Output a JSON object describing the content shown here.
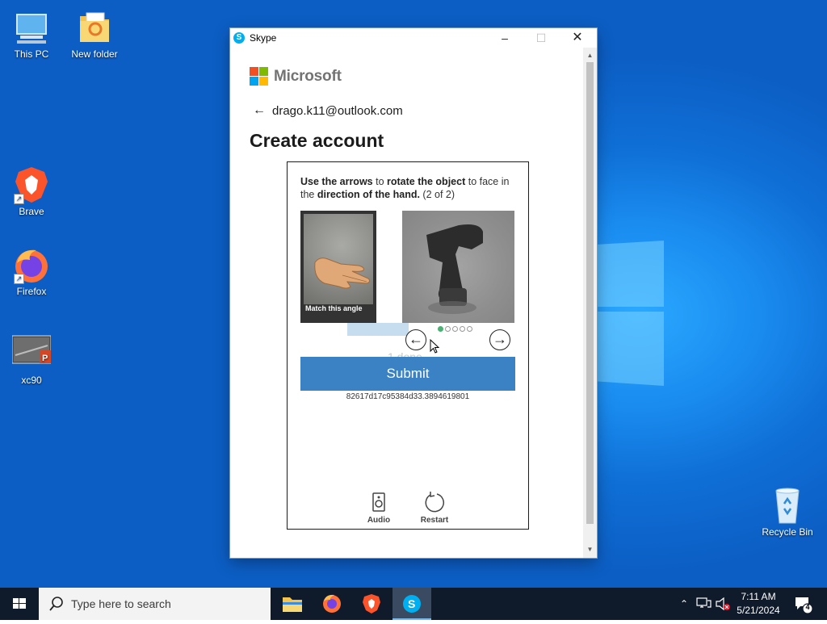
{
  "desktop": {
    "icons": [
      {
        "label": "This PC",
        "icon": "computer-icon"
      },
      {
        "label": "New folder",
        "icon": "folder-icon"
      },
      {
        "label": "Brave",
        "icon": "brave-icon"
      },
      {
        "label": "Firefox",
        "icon": "firefox-icon"
      },
      {
        "label": "xc90",
        "icon": "powerpoint-file-icon"
      },
      {
        "label": "Recycle Bin",
        "icon": "recycle-bin-icon"
      }
    ]
  },
  "window": {
    "title": "Skype",
    "brand": "Microsoft",
    "account_email": "drago.k11@outlook.com",
    "heading": "Create account",
    "challenge": {
      "instr_1": "Use the arrows",
      "instr_2": " to ",
      "instr_3": "rotate the object",
      "instr_4": " to face in the ",
      "instr_5": "direction of the hand.",
      "instr_6": " (2 of 2)",
      "reference_caption": "Match this angle",
      "progress_done": "1 done",
      "progress_step": 1,
      "progress_total": 5,
      "submit_label": "Submit",
      "token": "82617d17c95384d33.3894619801",
      "audio_label": "Audio",
      "restart_label": "Restart"
    }
  },
  "taskbar": {
    "search_placeholder": "Type here to search",
    "time": "7:11 AM",
    "date": "5/21/2024",
    "notification_count": "4"
  },
  "colors": {
    "desktop_blue": "#0c5ec4",
    "submit_blue": "#3b82c4",
    "skype_blue": "#00aff0",
    "taskbar": "#0f1a2a"
  }
}
